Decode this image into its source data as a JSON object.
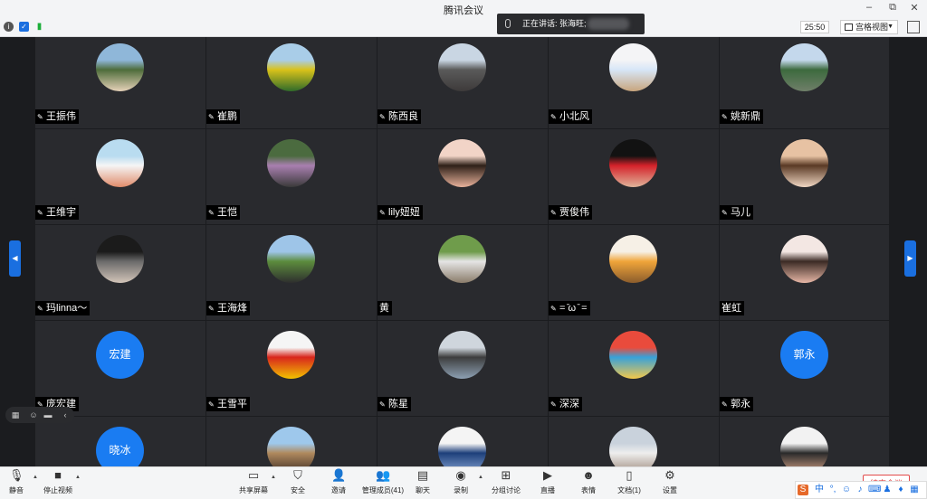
{
  "window": {
    "title": "腾讯会议",
    "min": "–",
    "restore": "⧉",
    "close": "✕"
  },
  "toolbar": {
    "timer": "25:50",
    "view_label": "宫格视图"
  },
  "speaking": {
    "text": "正在讲话: 张海旺;"
  },
  "participants": [
    {
      "name": "王振伟",
      "mic_icon": "mic-off-icon",
      "avatar_colors": [
        "#8fb7d9",
        "#4e6c3a",
        "#e6d2b9"
      ]
    },
    {
      "name": "崔鹏",
      "mic_icon": "mic-off-icon",
      "avatar_colors": [
        "#a9cde8",
        "#d9c21a",
        "#2f6b2a"
      ]
    },
    {
      "name": "陈西良",
      "mic_icon": "mic-off-icon",
      "avatar_colors": [
        "#c9d6e3",
        "#5a5a5a",
        "#3d3a3a"
      ]
    },
    {
      "name": "小北风",
      "mic_icon": "mic-off-icon",
      "avatar_colors": [
        "#f4f4f6",
        "#d7e6f7",
        "#c8a57d"
      ]
    },
    {
      "name": "姚新鼎",
      "mic_icon": "mic-off-icon",
      "avatar_colors": [
        "#c4d8ec",
        "#3d6a3e",
        "#6f7f69"
      ]
    },
    {
      "name": "王维宇",
      "mic_icon": "mic-off-icon",
      "avatar_colors": [
        "#b9dcf0",
        "#f5f5f5",
        "#e08b6a"
      ]
    },
    {
      "name": "王恺",
      "mic_icon": "mic-off-icon",
      "avatar_colors": [
        "#4b6b3f",
        "#a97fb0",
        "#3a3a3a"
      ]
    },
    {
      "name": "lily妞妞",
      "mic_icon": "mic-off-icon",
      "avatar_colors": [
        "#f2d4c7",
        "#2e2018",
        "#e8b29b"
      ]
    },
    {
      "name": "贾俊伟",
      "mic_icon": "mic-off-icon",
      "avatar_colors": [
        "#121212",
        "#d4222a",
        "#e0b49a"
      ]
    },
    {
      "name": "马儿",
      "mic_icon": "mic-off-icon",
      "avatar_colors": [
        "#e7c2a3",
        "#5a3a25",
        "#f0d7c3"
      ]
    },
    {
      "name": "玛linna～",
      "mic_icon": "mic-off-icon",
      "avatar_colors": [
        "#1b1b1b",
        "#6a6a6a",
        "#d3c5b9"
      ]
    },
    {
      "name": "王海烽",
      "mic_icon": "mic-off-icon",
      "avatar_colors": [
        "#9ec5e8",
        "#5c8c3d",
        "#2e2e2e"
      ]
    },
    {
      "name": "黄",
      "mic_icon": "",
      "avatar_colors": [
        "#6f9c4b",
        "#e5e5e5",
        "#8a7c6a"
      ]
    },
    {
      "name": "=  ̄ω ̄ =",
      "mic_icon": "mic-off-icon",
      "avatar_colors": [
        "#f6f0e6",
        "#f0a53a",
        "#8b5c2c"
      ]
    },
    {
      "name": "崔虹",
      "mic_icon": "",
      "avatar_colors": [
        "#f3e7e3",
        "#3b2a24",
        "#e7b7a6"
      ]
    },
    {
      "name": "庞宏建",
      "mic_icon": "mic-off-icon",
      "avatar_text": "宏建"
    },
    {
      "name": "王雪平",
      "mic_icon": "mic-off-icon",
      "avatar_colors": [
        "#f5f5f5",
        "#d8261c",
        "#f2c200"
      ]
    },
    {
      "name": "陈星",
      "mic_icon": "mic-off-icon",
      "avatar_colors": [
        "#cfd6dd",
        "#3d3d3d",
        "#8da0b3"
      ]
    },
    {
      "name": "深深",
      "mic_icon": "mic-off-icon",
      "avatar_colors": [
        "#e94b3c",
        "#37a1d9",
        "#f4c84a"
      ]
    },
    {
      "name": "郭永",
      "mic_icon": "mic-off-icon",
      "avatar_text": "郭永"
    },
    {
      "name": "",
      "mic_icon": "",
      "avatar_text": "晓冰"
    },
    {
      "name": "",
      "mic_icon": "",
      "avatar_colors": [
        "#9ec8ec",
        "#b08a5e",
        "#3a2a22"
      ]
    },
    {
      "name": "",
      "mic_icon": "",
      "avatar_colors": [
        "#f4f4f4",
        "#1d3f7a",
        "#8aa7d6"
      ]
    },
    {
      "name": "",
      "mic_icon": "",
      "avatar_colors": [
        "#c9d2dc",
        "#eeeeee",
        "#9a8778"
      ]
    },
    {
      "name": "",
      "mic_icon": "",
      "avatar_colors": [
        "#f2f2f2",
        "#2a2a2a",
        "#d9a58a"
      ]
    }
  ],
  "bottombar": {
    "mute": "静音",
    "stop_video": "停止视频",
    "share": "共享屏幕",
    "security": "安全",
    "invite": "邀请",
    "members": "管理成员(41)",
    "chat": "聊天",
    "record": "录制",
    "breakout": "分组讨论",
    "live": "直播",
    "reactions": "表情",
    "docs": "文档(1)",
    "settings": "设置",
    "end": "结束会议"
  },
  "ime": {
    "label_zh": "中"
  },
  "colors": {
    "accent": "#1a7cf2",
    "tile_bg": "#292a2e",
    "end_red": "#e24a4a"
  }
}
